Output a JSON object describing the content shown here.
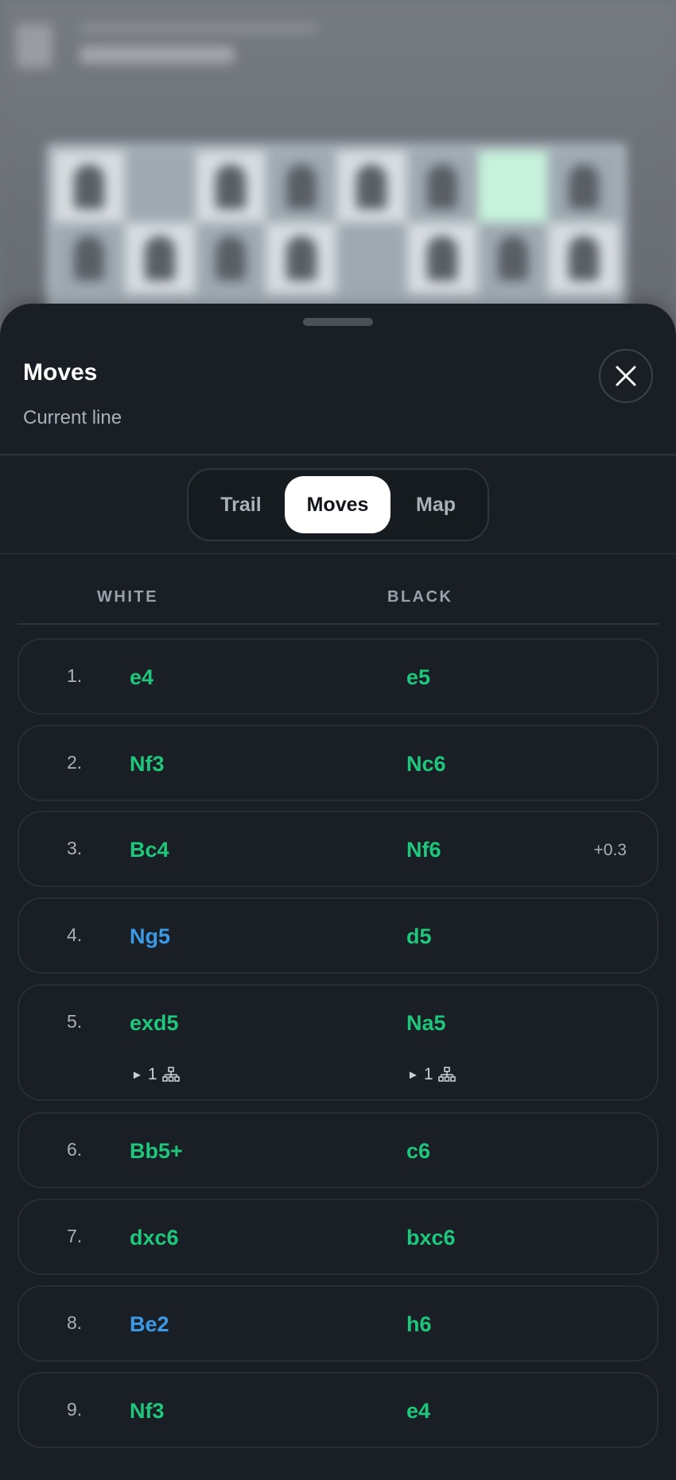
{
  "sheet": {
    "title": "Moves",
    "subtitle": "Current line",
    "close_icon": "close-icon"
  },
  "tabs": [
    {
      "label": "Trail",
      "active": false
    },
    {
      "label": "Moves",
      "active": true
    },
    {
      "label": "Map",
      "active": false
    }
  ],
  "columns": {
    "white": "WHITE",
    "black": "BLACK"
  },
  "colors": {
    "best_move": "#1ec77b",
    "alt_move": "#3b9ae8",
    "active_tab_bg": "#ffffff",
    "sheet_bg": "#1a1f25"
  },
  "moves": [
    {
      "number": "1.",
      "white": "e4",
      "black": "e5",
      "white_color": "green",
      "black_color": "green",
      "eval": ""
    },
    {
      "number": "2.",
      "white": "Nf3",
      "black": "Nc6",
      "white_color": "green",
      "black_color": "green",
      "eval": ""
    },
    {
      "number": "3.",
      "white": "Bc4",
      "black": "Nf6",
      "white_color": "green",
      "black_color": "green",
      "eval": "+0.3"
    },
    {
      "number": "4.",
      "white": "Ng5",
      "black": "d5",
      "white_color": "blue",
      "black_color": "green",
      "eval": ""
    },
    {
      "number": "5.",
      "white": "exd5",
      "black": "Na5",
      "white_color": "green",
      "black_color": "green",
      "eval": "",
      "variations": {
        "white": "1",
        "black": "1"
      }
    },
    {
      "number": "6.",
      "white": "Bb5+",
      "black": "c6",
      "white_color": "green",
      "black_color": "green",
      "eval": ""
    },
    {
      "number": "7.",
      "white": "dxc6",
      "black": "bxc6",
      "white_color": "green",
      "black_color": "green",
      "eval": ""
    },
    {
      "number": "8.",
      "white": "Be2",
      "black": "h6",
      "white_color": "blue",
      "black_color": "green",
      "eval": ""
    },
    {
      "number": "9.",
      "white": "Nf3",
      "black": "e4",
      "white_color": "green",
      "black_color": "green",
      "eval": ""
    }
  ]
}
